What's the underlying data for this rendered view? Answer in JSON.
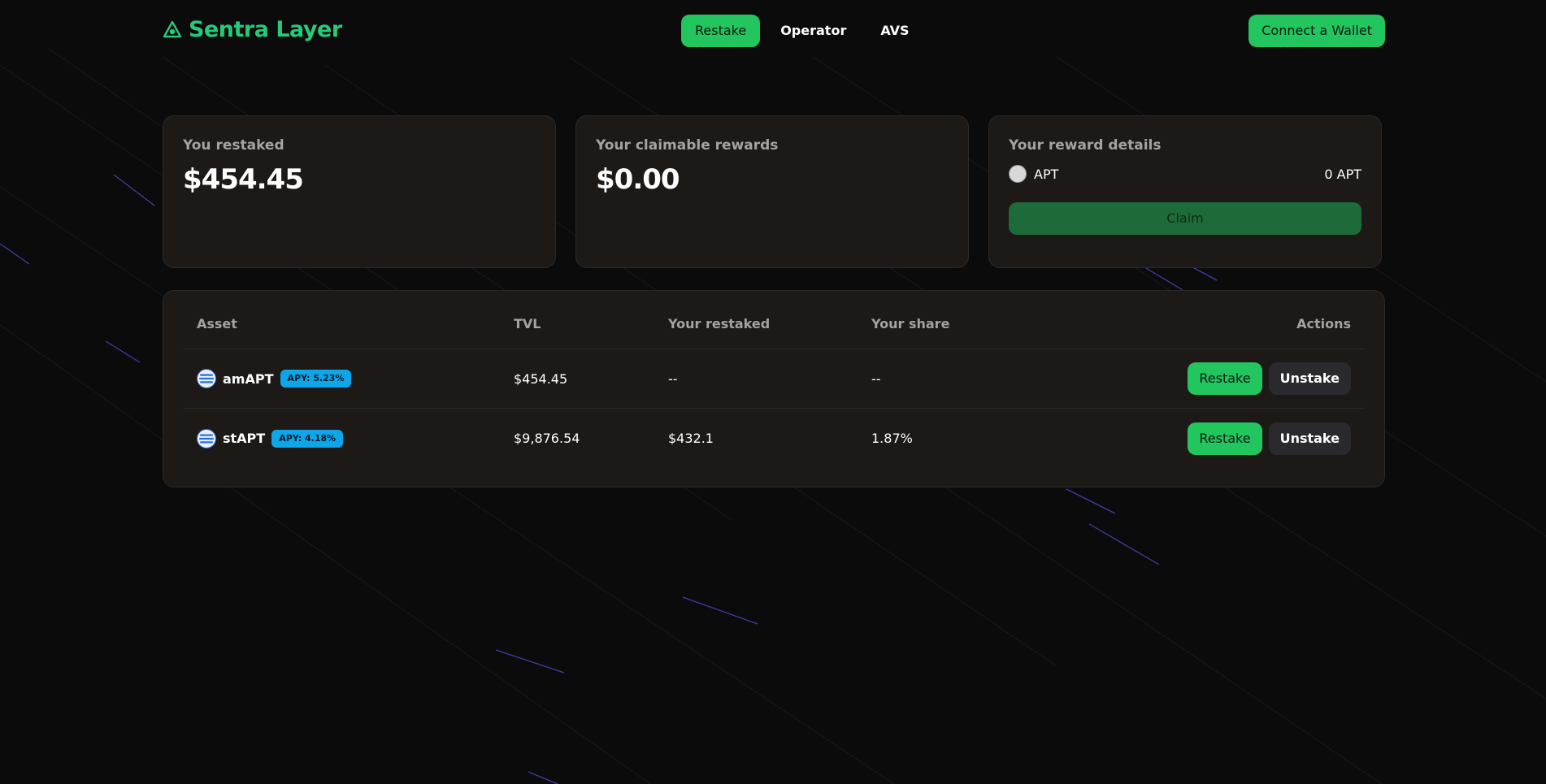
{
  "brand": {
    "name": "Sentra Layer",
    "color": "#27c97a"
  },
  "nav": {
    "items": [
      {
        "label": "Restake",
        "active": true
      },
      {
        "label": "Operator",
        "active": false
      },
      {
        "label": "AVS",
        "active": false
      }
    ],
    "connect_label": "Connect a Wallet"
  },
  "cards": {
    "restaked": {
      "title": "You restaked",
      "value": "$454.45"
    },
    "claimable": {
      "title": "Your claimable rewards",
      "value": "$0.00"
    },
    "details": {
      "title": "Your reward details",
      "token": "APT",
      "amount": "0 APT",
      "claim_label": "Claim"
    }
  },
  "table": {
    "headers": {
      "asset": "Asset",
      "tvl": "TVL",
      "restaked": "Your restaked",
      "share": "Your share",
      "actions": "Actions"
    },
    "rows": [
      {
        "asset": "amAPT",
        "apy": "APY: 5.23%",
        "tvl": "$454.45",
        "restaked": "--",
        "share": "--",
        "restake_label": "Restake",
        "unstake_label": "Unstake"
      },
      {
        "asset": "stAPT",
        "apy": "APY: 4.18%",
        "tvl": "$9,876.54",
        "restaked": "$432.1",
        "share": "1.87%",
        "restake_label": "Restake",
        "unstake_label": "Unstake"
      }
    ]
  },
  "colors": {
    "accent": "#22c55e",
    "apy_badge": "#0ea5e9",
    "card": "#1c1917",
    "background": "#0c0b0b"
  }
}
